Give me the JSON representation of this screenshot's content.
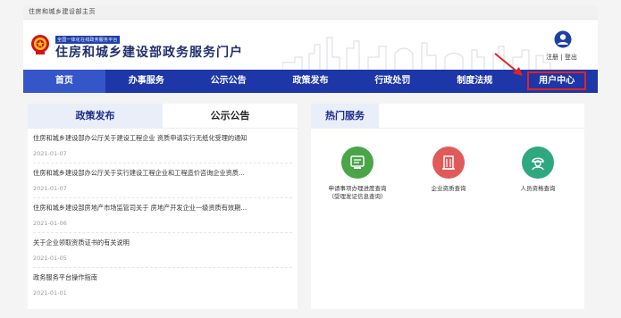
{
  "breadcrumb": "住房和城乡建设部主页",
  "brand": {
    "small_tag": "全国一体化在线政务服务平台",
    "title": "住房和城乡建设部政务服务门户"
  },
  "auth": {
    "register": "注册",
    "separator": "|",
    "logout": "登出"
  },
  "nav": {
    "items": [
      {
        "label": "首页"
      },
      {
        "label": "办事服务"
      },
      {
        "label": "公示公告"
      },
      {
        "label": "政策发布"
      },
      {
        "label": "行政处罚"
      },
      {
        "label": "制度法规"
      },
      {
        "label": "用户中心"
      }
    ],
    "active_index": 0,
    "highlighted_index": 6
  },
  "left_panel": {
    "tabs": [
      {
        "label": "政策发布"
      },
      {
        "label": "公示公告"
      }
    ],
    "news": [
      {
        "title": "住房和城乡建设部办公厅关于建设工程企业 资质申请实行无纸化受理的通知",
        "date": "2021-01-07"
      },
      {
        "title": "住房和城乡建设部办公厅关于实行建设工程企业和工程造价咨询企业资质...",
        "date": "2021-01-07"
      },
      {
        "title": "住房和城乡建设部房地产市场监管司关于 房地产开发企业一级资质有效期...",
        "date": "2021-01-06"
      },
      {
        "title": "关于企业领取资质证书的有关说明",
        "date": "2021-01-05"
      },
      {
        "title": "政务服务平台操作指南",
        "date": "2021-01-01"
      }
    ]
  },
  "right_panel": {
    "title": "热门服务",
    "services": [
      {
        "label_line1": "申请事项办理进度查询",
        "label_line2": "（受理发证信息查询）",
        "color": "#4aa548"
      },
      {
        "label_line1": "企业资质查询",
        "label_line2": "",
        "color": "#e05a5a"
      },
      {
        "label_line1": "人员资格查询",
        "label_line2": "",
        "color": "#2fa880"
      }
    ]
  },
  "colors": {
    "nav_bg": "#1d36a8",
    "highlight_box": "#e02424",
    "brand": "#1f2f6e"
  }
}
